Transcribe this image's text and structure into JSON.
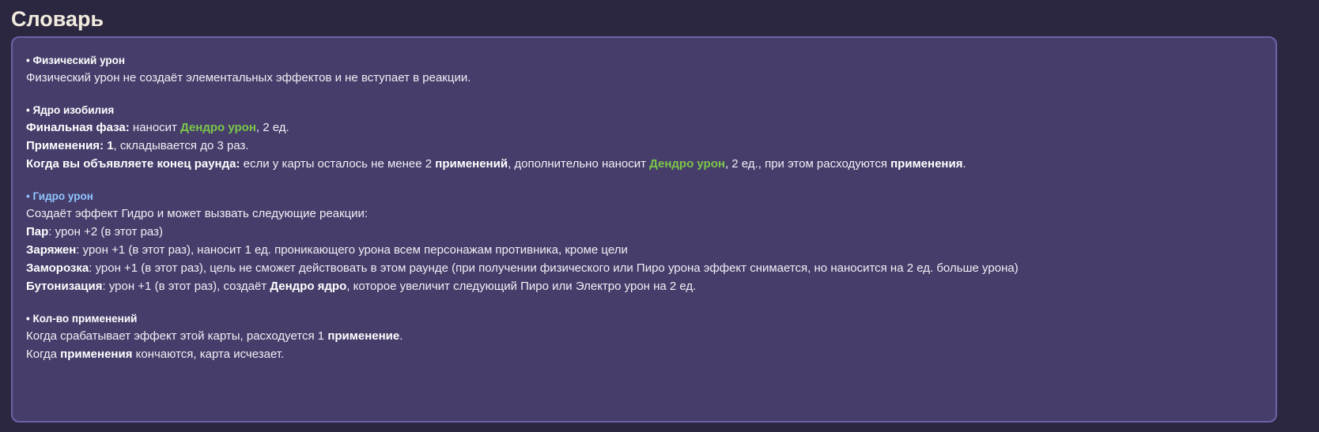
{
  "page": {
    "title": "Словарь"
  },
  "colors": {
    "background": "#2c2740",
    "panel": "#463d6a",
    "panel_border": "#6c63a8",
    "dendro": "#7bc64a",
    "hydro": "#8fc5ff"
  },
  "glossary": {
    "physical": {
      "title": "• Физический урон",
      "desc": "Физический урон не создаёт элементальных эффектов и не вступает в реакции."
    },
    "core": {
      "title": "• Ядро изобилия",
      "final_label": "Финальная фаза:",
      "final_pre": " наносит ",
      "final_dmg": "Дендро урон",
      "final_post": ", 2 ед.",
      "uses_label": "Применения: 1",
      "uses_post": ", складывается до 3 раз.",
      "round_label": "Когда вы объявляете конец раунда:",
      "round_pre": " если у карты осталось не менее 2 ",
      "round_uses": "применений",
      "round_mid": ", дополнительно наносит ",
      "round_dmg": "Дендро урон",
      "round_mid2": ", 2 ед., при этом расходуются ",
      "round_uses2": "применения",
      "round_end": "."
    },
    "hydro": {
      "title": "• Гидро урон",
      "intro": "Создаёт эффект Гидро и может вызвать следующие реакции:",
      "reactions": [
        {
          "name": "Пар",
          "text": ": урон +2 (в этот раз)"
        },
        {
          "name": "Заряжен",
          "text": ": урон +1 (в этот раз), наносит 1 ед. проникающего урона всем персонажам противника, кроме цели"
        },
        {
          "name": "Заморозка",
          "text": ": урон +1 (в этот раз), цель не сможет действовать в этом раунде (при получении физического или Пиро урона эффект снимается, но наносится на 2 ед. больше урона)"
        }
      ],
      "bloom_name": "Бутонизация",
      "bloom_pre": ": урон +1 (в этот раз), создаёт ",
      "bloom_core": "Дендро ядро",
      "bloom_post": ", которое увеличит следующий Пиро или Электро урон на 2 ед."
    },
    "usage": {
      "title": "• Кол-во применений",
      "line1_pre": "Когда срабатывает эффект этой карты, расходуется 1 ",
      "line1_bold": "применение",
      "line1_end": ".",
      "line2_pre": "Когда ",
      "line2_bold": "применения",
      "line2_post": " кончаются, карта исчезает."
    }
  }
}
